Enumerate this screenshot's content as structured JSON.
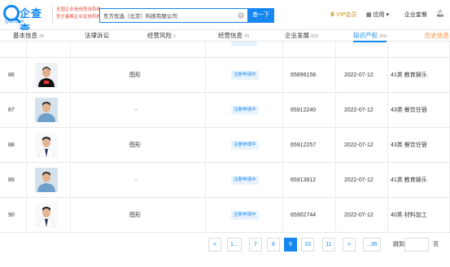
{
  "header": {
    "logo_text": "企查查",
    "logo_domain": "Qcc.com",
    "official_line1": "全国企业信用查询系统",
    "official_line2": "官方备案企业征信机构",
    "search_value": "东方优选（北京）科技有限公司",
    "search_button": "查一下",
    "vip_label": "VIP会员",
    "apps_label": "应用",
    "enterprise_label": "企业套餐"
  },
  "tabs": [
    {
      "label": "基本信息",
      "count": "28"
    },
    {
      "label": "法律诉讼",
      "count": ""
    },
    {
      "label": "经营风险",
      "count": "2"
    },
    {
      "label": "经营信息",
      "count": "29"
    },
    {
      "label": "企业发展",
      "count": "833"
    },
    {
      "label": "知识产权",
      "count": "356"
    },
    {
      "label": "历史信息",
      "count": ""
    }
  ],
  "rows": [
    {
      "index": "86",
      "name": "图形",
      "status": "注册申请中",
      "reg_no": "65896158",
      "date": "2022-07-12",
      "class": "41类 教育娱乐"
    },
    {
      "index": "87",
      "name": "-",
      "status": "注册申请中",
      "reg_no": "65912240",
      "date": "2022-07-12",
      "class": "43类 餐饮住宿"
    },
    {
      "index": "88",
      "name": "图形",
      "status": "注册申请中",
      "reg_no": "65912257",
      "date": "2022-07-12",
      "class": "43类 餐饮住宿"
    },
    {
      "index": "89",
      "name": "-",
      "status": "注册申请中",
      "reg_no": "65913812",
      "date": "2022-07-12",
      "class": "41类 教育娱乐"
    },
    {
      "index": "90",
      "name": "图形",
      "status": "注册申请中",
      "reg_no": "65902744",
      "date": "2022-07-12",
      "class": "40类 材料加工"
    }
  ],
  "pagination": {
    "prev": "<",
    "first": "1...",
    "pages": [
      "7",
      "8",
      "9",
      "10",
      "11"
    ],
    "current": "9",
    "next": ">",
    "last": "...36",
    "jump_label": "跳到",
    "page_unit": "页"
  },
  "colors": {
    "accent": "#1687f0",
    "vip": "#c88a1c",
    "history_tab": "#f08b3c"
  }
}
